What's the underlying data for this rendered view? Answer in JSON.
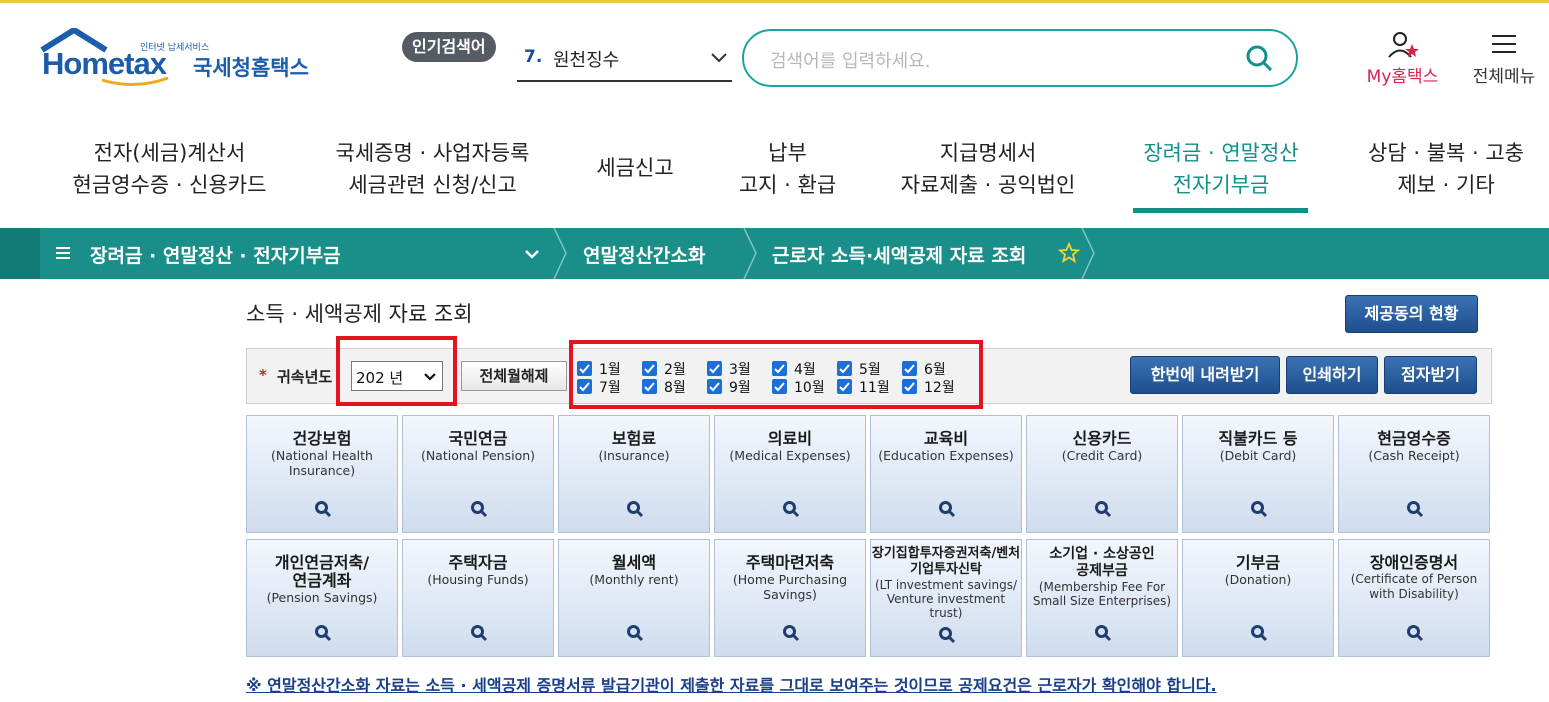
{
  "header": {
    "logo_small": "인터넷 납세서비스",
    "logo_text": "Hometax",
    "logo_korean": "국세청홈택스",
    "popular_badge": "인기검색어",
    "popular_rank": "7.",
    "popular_term": "원천징수",
    "search_placeholder": "검색어를 입력하세요.",
    "my_hometax": "My홈택스",
    "all_menu": "전체메뉴"
  },
  "main_nav": [
    {
      "line1": "전자(세금)계산서",
      "line2": "현금영수증 · 신용카드"
    },
    {
      "line1": "국세증명 · 사업자등록",
      "line2": "세금관련 신청/신고"
    },
    {
      "line1": "세금신고",
      "line2": ""
    },
    {
      "line1": "납부",
      "line2": "고지 · 환급"
    },
    {
      "line1": "지급명세서",
      "line2": "자료제출 · 공익법인"
    },
    {
      "line1": "장려금 · 연말정산",
      "line2": "전자기부금",
      "active": true
    },
    {
      "line1": "상담 · 불복 · 고충",
      "line2": "제보 · 기타"
    }
  ],
  "breadcrumb": {
    "section": "장려금 · 연말정산 · 전자기부금",
    "sub": "연말정산간소화",
    "page": "근로자 소득·세액공제 자료 조회"
  },
  "page": {
    "title": "소득 · 세액공제 자료 조회",
    "status_button": "제공동의 현황",
    "required_mark": "*",
    "year_label": "귀속년도",
    "year_value": "202 년",
    "unselect_all": "전체월해제",
    "download_button": "한번에 내려받기",
    "print_button": "인쇄하기",
    "braille_button": "점자받기",
    "months": [
      {
        "label": "1월",
        "checked": true
      },
      {
        "label": "2월",
        "checked": true
      },
      {
        "label": "3월",
        "checked": true
      },
      {
        "label": "4월",
        "checked": true
      },
      {
        "label": "5월",
        "checked": true
      },
      {
        "label": "6월",
        "checked": true
      },
      {
        "label": "7월",
        "checked": true
      },
      {
        "label": "8월",
        "checked": true
      },
      {
        "label": "9월",
        "checked": true
      },
      {
        "label": "10월",
        "checked": true
      },
      {
        "label": "11월",
        "checked": true
      },
      {
        "label": "12월",
        "checked": true
      }
    ],
    "tiles": [
      {
        "ko": "건강보험",
        "en": "(National Health Insurance)"
      },
      {
        "ko": "국민연금",
        "en": "(National Pension)"
      },
      {
        "ko": "보험료",
        "en": "(Insurance)"
      },
      {
        "ko": "의료비",
        "en": "(Medical Expenses)"
      },
      {
        "ko": "교육비",
        "en": "(Education Expenses)"
      },
      {
        "ko": "신용카드",
        "en": "(Credit Card)"
      },
      {
        "ko": "직불카드 등",
        "en": "(Debit Card)"
      },
      {
        "ko": "현금영수증",
        "en": "(Cash Receipt)"
      },
      {
        "ko": "개인연금저축/연금계좌",
        "en": "(Pension Savings)"
      },
      {
        "ko": "주택자금",
        "en": "(Housing Funds)"
      },
      {
        "ko": "월세액",
        "en": "(Monthly rent)"
      },
      {
        "ko": "주택마련저축",
        "en": "(Home Purchasing Savings)"
      },
      {
        "ko": "장기집합투자증권저축/벤처기업투자신탁",
        "en": "(LT investment savings/ Venture investment trust)"
      },
      {
        "ko": "소기업 · 소상공인 공제부금",
        "en": "(Membership Fee For Small Size Enterprises)"
      },
      {
        "ko": "기부금",
        "en": "(Donation)"
      },
      {
        "ko": "장애인증명서",
        "en": "(Certificate of Person with Disability)"
      }
    ],
    "notice": "※ 연말정산간소화 자료는 소득 · 세액공제 증명서류 발급기관이 제출한 자료를 그대로 보여주는 것이므로 공제요건은 근로자가 확인해야 합니다."
  },
  "colors": {
    "teal": "#1a8e88",
    "brand_blue": "#1b5cab",
    "highlight_red": "#e2141d",
    "my_pink": "#d6264f"
  },
  "icons": [
    "search-icon",
    "chevron-down-icon",
    "user-icon",
    "hamburger-icon",
    "star-icon",
    "magnifier-icon",
    "checkbox-icon"
  ]
}
